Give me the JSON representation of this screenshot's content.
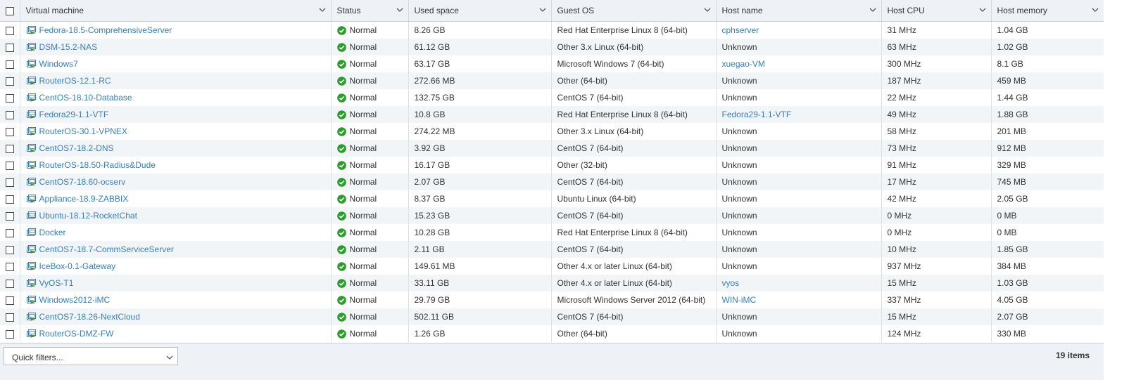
{
  "columns": [
    {
      "key": "vm",
      "label": "Virtual machine"
    },
    {
      "key": "status",
      "label": "Status"
    },
    {
      "key": "used",
      "label": "Used space"
    },
    {
      "key": "os",
      "label": "Guest OS"
    },
    {
      "key": "host",
      "label": "Host name"
    },
    {
      "key": "cpu",
      "label": "Host CPU"
    },
    {
      "key": "mem",
      "label": "Host memory"
    }
  ],
  "rows": [
    {
      "vm": "Fedora-18.5-ComprehensiveServer",
      "powered": true,
      "status": "Normal",
      "used": "8.26 GB",
      "os": "Red Hat Enterprise Linux 8 (64-bit)",
      "host": "cphserver",
      "host_link": true,
      "cpu": "31 MHz",
      "mem": "1.04 GB"
    },
    {
      "vm": "DSM-15.2-NAS",
      "powered": true,
      "status": "Normal",
      "used": "61.12 GB",
      "os": "Other 3.x Linux (64-bit)",
      "host": "Unknown",
      "host_link": false,
      "cpu": "63 MHz",
      "mem": "1.02 GB"
    },
    {
      "vm": "Windows7",
      "powered": true,
      "status": "Normal",
      "used": "63.17 GB",
      "os": "Microsoft Windows 7 (64-bit)",
      "host": "xuegao-VM",
      "host_link": true,
      "cpu": "300 MHz",
      "mem": "8.1 GB"
    },
    {
      "vm": "RouterOS-12.1-RC",
      "powered": true,
      "status": "Normal",
      "used": "272.66 MB",
      "os": "Other (64-bit)",
      "host": "Unknown",
      "host_link": false,
      "cpu": "187 MHz",
      "mem": "459 MB"
    },
    {
      "vm": "CentOS-18.10-Database",
      "powered": true,
      "status": "Normal",
      "used": "132.75 GB",
      "os": "CentOS 7 (64-bit)",
      "host": "Unknown",
      "host_link": false,
      "cpu": "22 MHz",
      "mem": "1.44 GB"
    },
    {
      "vm": "Fedora29-1.1-VTF",
      "powered": true,
      "status": "Normal",
      "used": "10.8 GB",
      "os": "Red Hat Enterprise Linux 8 (64-bit)",
      "host": "Fedora29-1.1-VTF",
      "host_link": true,
      "cpu": "49 MHz",
      "mem": "1.88 GB"
    },
    {
      "vm": "RouterOS-30.1-VPNEX",
      "powered": true,
      "status": "Normal",
      "used": "274.22 MB",
      "os": "Other 3.x Linux (64-bit)",
      "host": "Unknown",
      "host_link": false,
      "cpu": "58 MHz",
      "mem": "201 MB"
    },
    {
      "vm": "CentOS7-18.2-DNS",
      "powered": true,
      "status": "Normal",
      "used": "3.92 GB",
      "os": "CentOS 7 (64-bit)",
      "host": "Unknown",
      "host_link": false,
      "cpu": "73 MHz",
      "mem": "912 MB"
    },
    {
      "vm": "RouterOS-18.50-Radius&Dude",
      "powered": true,
      "status": "Normal",
      "used": "16.17 GB",
      "os": "Other (32-bit)",
      "host": "Unknown",
      "host_link": false,
      "cpu": "91 MHz",
      "mem": "329 MB"
    },
    {
      "vm": "CentOS7-18.60-ocserv",
      "powered": true,
      "status": "Normal",
      "used": "2.07 GB",
      "os": "CentOS 7 (64-bit)",
      "host": "Unknown",
      "host_link": false,
      "cpu": "17 MHz",
      "mem": "745 MB"
    },
    {
      "vm": "Appliance-18.9-ZABBIX",
      "powered": true,
      "status": "Normal",
      "used": "8.37 GB",
      "os": "Ubuntu Linux (64-bit)",
      "host": "Unknown",
      "host_link": false,
      "cpu": "42 MHz",
      "mem": "2.05 GB"
    },
    {
      "vm": "Ubuntu-18.12-RocketChat",
      "powered": false,
      "status": "Normal",
      "used": "15.23 GB",
      "os": "CentOS 7 (64-bit)",
      "host": "Unknown",
      "host_link": false,
      "cpu": "0 MHz",
      "mem": "0 MB"
    },
    {
      "vm": "Docker",
      "powered": false,
      "status": "Normal",
      "used": "10.28 GB",
      "os": "Red Hat Enterprise Linux 8 (64-bit)",
      "host": "Unknown",
      "host_link": false,
      "cpu": "0 MHz",
      "mem": "0 MB"
    },
    {
      "vm": "CentOS7-18.7-CommServiceServer",
      "powered": true,
      "status": "Normal",
      "used": "2.11 GB",
      "os": "CentOS 7 (64-bit)",
      "host": "Unknown",
      "host_link": false,
      "cpu": "10 MHz",
      "mem": "1.85 GB"
    },
    {
      "vm": "IceBox-0.1-Gateway",
      "powered": true,
      "status": "Normal",
      "used": "149.61 MB",
      "os": "Other 4.x or later Linux (64-bit)",
      "host": "Unknown",
      "host_link": false,
      "cpu": "937 MHz",
      "mem": "384 MB"
    },
    {
      "vm": "VyOS-T1",
      "powered": true,
      "status": "Normal",
      "used": "33.11 GB",
      "os": "Other 4.x or later Linux (64-bit)",
      "host": "vyos",
      "host_link": true,
      "cpu": "15 MHz",
      "mem": "1.03 GB"
    },
    {
      "vm": "Windows2012-iMC",
      "powered": true,
      "status": "Normal",
      "used": "29.79 GB",
      "os": "Microsoft Windows Server 2012 (64-bit)",
      "host": "WIN-iMC",
      "host_link": true,
      "cpu": "337 MHz",
      "mem": "4.05 GB"
    },
    {
      "vm": "CentOS7-18.26-NextCloud",
      "powered": true,
      "status": "Normal",
      "used": "502.11 GB",
      "os": "CentOS 7 (64-bit)",
      "host": "Unknown",
      "host_link": false,
      "cpu": "15 MHz",
      "mem": "2.07 GB"
    },
    {
      "vm": "RouterOS-DMZ-FW",
      "powered": true,
      "status": "Normal",
      "used": "1.26 GB",
      "os": "Other (64-bit)",
      "host": "Unknown",
      "host_link": false,
      "cpu": "124 MHz",
      "mem": "330 MB"
    }
  ],
  "footer": {
    "quick_filter_label": "Quick filters...",
    "item_count": "19 items"
  },
  "icons": {
    "vm_powered_on": "vm-powered-on-icon",
    "vm_powered_off": "vm-powered-off-icon",
    "status_ok": "status-ok-check-icon",
    "column_menu": "chevron-down-icon"
  },
  "colors": {
    "link": "#3a7fb3",
    "status_ok": "#2a9d2a",
    "header_bg": "#eef1f5",
    "row_alt_bg": "#f2f5f8"
  }
}
